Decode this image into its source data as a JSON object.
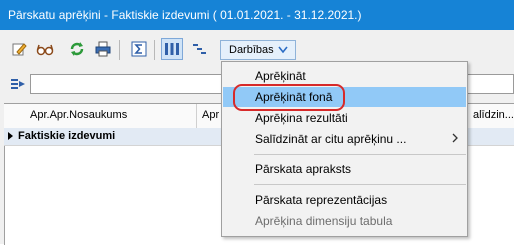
{
  "window": {
    "title": "Pārskatu aprēķini - Faktiskie izdevumi ( 01.01.2021. - 31.12.2021.)"
  },
  "toolbar": {
    "buttons": [
      {
        "icon": "pencil-icon"
      },
      {
        "icon": "glasses-icon"
      },
      {
        "icon": "refresh-icon"
      },
      {
        "icon": "printer-icon"
      },
      {
        "icon": "sum-icon"
      },
      {
        "icon": "columns-icon"
      },
      {
        "icon": "tree-icon"
      }
    ],
    "actions_label": "Darbības"
  },
  "filter": {
    "value": ""
  },
  "grid": {
    "columns": [
      "Apr.Apr.Nosaukums",
      "Apr",
      "alīdzin..."
    ],
    "rows": [
      {
        "name": "Faktiskie izdevumi"
      }
    ]
  },
  "menu": {
    "items": [
      {
        "label": "Aprēķināt",
        "enabled": true
      },
      {
        "label": "Aprēķināt fonā",
        "enabled": true,
        "highlighted": true
      },
      {
        "label": "Aprēķina rezultāti",
        "enabled": true
      },
      {
        "label": "Salīdzināt ar citu aprēķinu ...",
        "enabled": true,
        "submenu": true
      },
      {
        "label": "Pārskata apraksts",
        "enabled": true
      },
      {
        "label": "Pārskata reprezentācijas",
        "enabled": true
      },
      {
        "label": "Aprēķina dimensiju tabula",
        "enabled": false
      }
    ]
  },
  "colors": {
    "titlebar": "#1683d6",
    "highlight": "#91c9f7",
    "annotation": "#d72a2a"
  }
}
